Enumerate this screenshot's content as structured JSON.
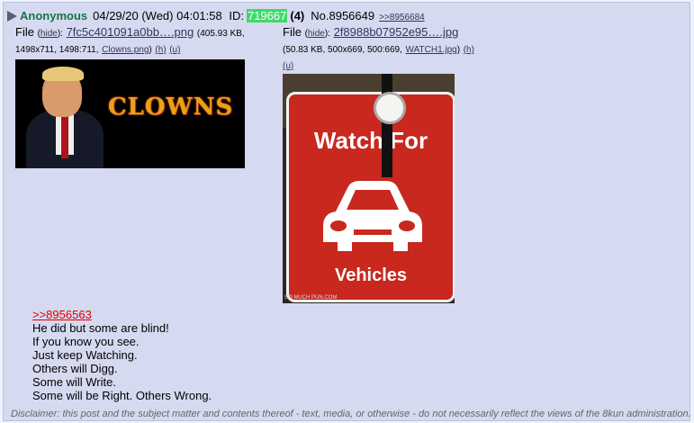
{
  "post": {
    "name": "Anonymous",
    "date": "04/29/20 (Wed) 04:01:58",
    "id_label": "ID:",
    "poster_id": "719667",
    "poster_count": "(4)",
    "post_number": "No.8956649",
    "backlink": ">>8956684",
    "colors": {
      "name": "#117743",
      "id_bg": "#3fd96b",
      "quote": "#dd0000",
      "post_bg": "#d6daf0"
    }
  },
  "files": [
    {
      "label": "File",
      "hide": "hide",
      "filename": "7fc5c401091a0bb….png",
      "meta_line1": "(405.93 KB,",
      "meta_line2": "1498x711, 1498:711,",
      "orig_name": "Clowns.png",
      "h": "(h)",
      "u": "(u)",
      "thumb_text": "CLOWNS"
    },
    {
      "label": "File",
      "hide": "hide",
      "filename": "2f8988b07952e95….jpg",
      "meta_line1": "(50.83 KB, 500x669, 500:669,",
      "orig_name": "WATCH1.jpg",
      "h": "(h)",
      "u": "(u)",
      "thumb_text_top": "Watch For",
      "thumb_text_bottom": "Vehicles",
      "thumb_credit": "SO MUCH PUN.COM"
    }
  ],
  "body": {
    "quote": ">>8956563",
    "lines": [
      "He did but some are blind!",
      "If you know you see.",
      "Just keep Watching.",
      "Others will Digg.",
      "Some will Write.",
      "Some will be Right. Others Wrong."
    ]
  },
  "disclaimer": "Disclaimer: this post and the subject matter and contents thereof - text, media, or otherwise - do not necessarily reflect the views of the 8kun administration."
}
